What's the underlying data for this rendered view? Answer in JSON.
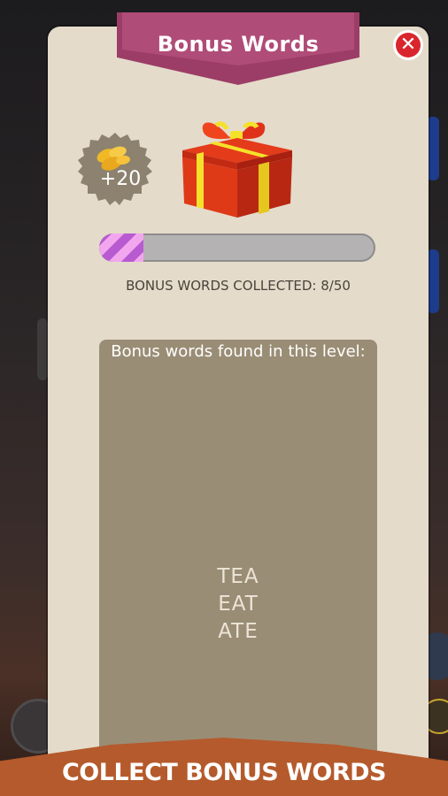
{
  "dialog": {
    "title": "Bonus Words"
  },
  "reward_badge": {
    "amount": "+20",
    "icon": "coins-icon"
  },
  "gift": {
    "icon": "gift-box-icon"
  },
  "progress": {
    "collected": 8,
    "total": 50,
    "fraction": 0.16,
    "label": "BONUS WORDS COLLECTED: 8/50"
  },
  "words_panel": {
    "heading": "Bonus words found in this level:",
    "words": [
      "TEA",
      "EAT",
      "ATE"
    ]
  },
  "banner": {
    "text": "COLLECT BONUS WORDS"
  },
  "colors": {
    "ribbon": "#9c3d67",
    "panel": "#e4dbcb",
    "words_box": "#9a8d75",
    "banner": "#b55a2c",
    "progress_fill": "#b85bd1"
  }
}
